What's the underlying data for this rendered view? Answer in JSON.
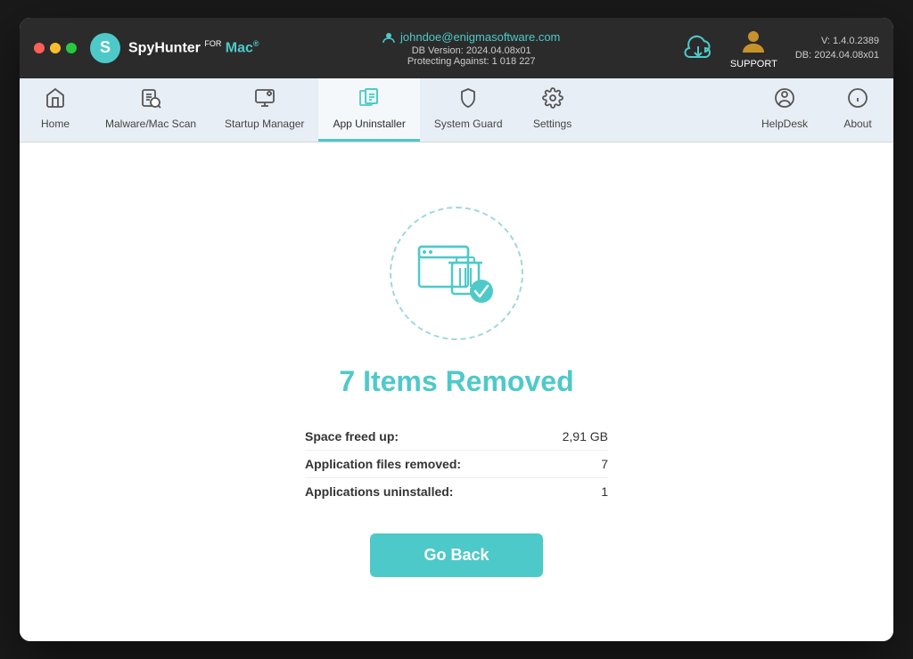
{
  "window": {
    "title": "SpyHunter for Mac"
  },
  "titlebar": {
    "email": "johndoe@enigmasoftware.com",
    "db_version": "DB Version: 2024.04.08x01",
    "protecting": "Protecting Against: 1 018 227",
    "support_label": "SUPPORT",
    "version_line1": "V: 1.4.0.2389",
    "version_line2": "DB:  2024.04.08x01"
  },
  "navbar": {
    "items": [
      {
        "id": "home",
        "label": "Home",
        "icon": "🏠",
        "active": false
      },
      {
        "id": "malware-scan",
        "label": "Malware/Mac Scan",
        "icon": "🔍",
        "active": false
      },
      {
        "id": "startup-manager",
        "label": "Startup Manager",
        "icon": "⚙",
        "active": false
      },
      {
        "id": "app-uninstaller",
        "label": "App Uninstaller",
        "icon": "🗑",
        "active": true
      },
      {
        "id": "system-guard",
        "label": "System Guard",
        "icon": "🛡",
        "active": false
      },
      {
        "id": "settings",
        "label": "Settings",
        "icon": "⚙",
        "active": false
      }
    ],
    "right_items": [
      {
        "id": "helpdesk",
        "label": "HelpDesk",
        "icon": "❓"
      },
      {
        "id": "about",
        "label": "About",
        "icon": "ℹ"
      }
    ]
  },
  "main": {
    "heading": "7 Items Removed",
    "stats": [
      {
        "label": "Space freed up:",
        "value": "2,91 GB"
      },
      {
        "label": "Application files removed:",
        "value": "7"
      },
      {
        "label": "Applications uninstalled:",
        "value": "1"
      }
    ],
    "button_label": "Go Back"
  }
}
